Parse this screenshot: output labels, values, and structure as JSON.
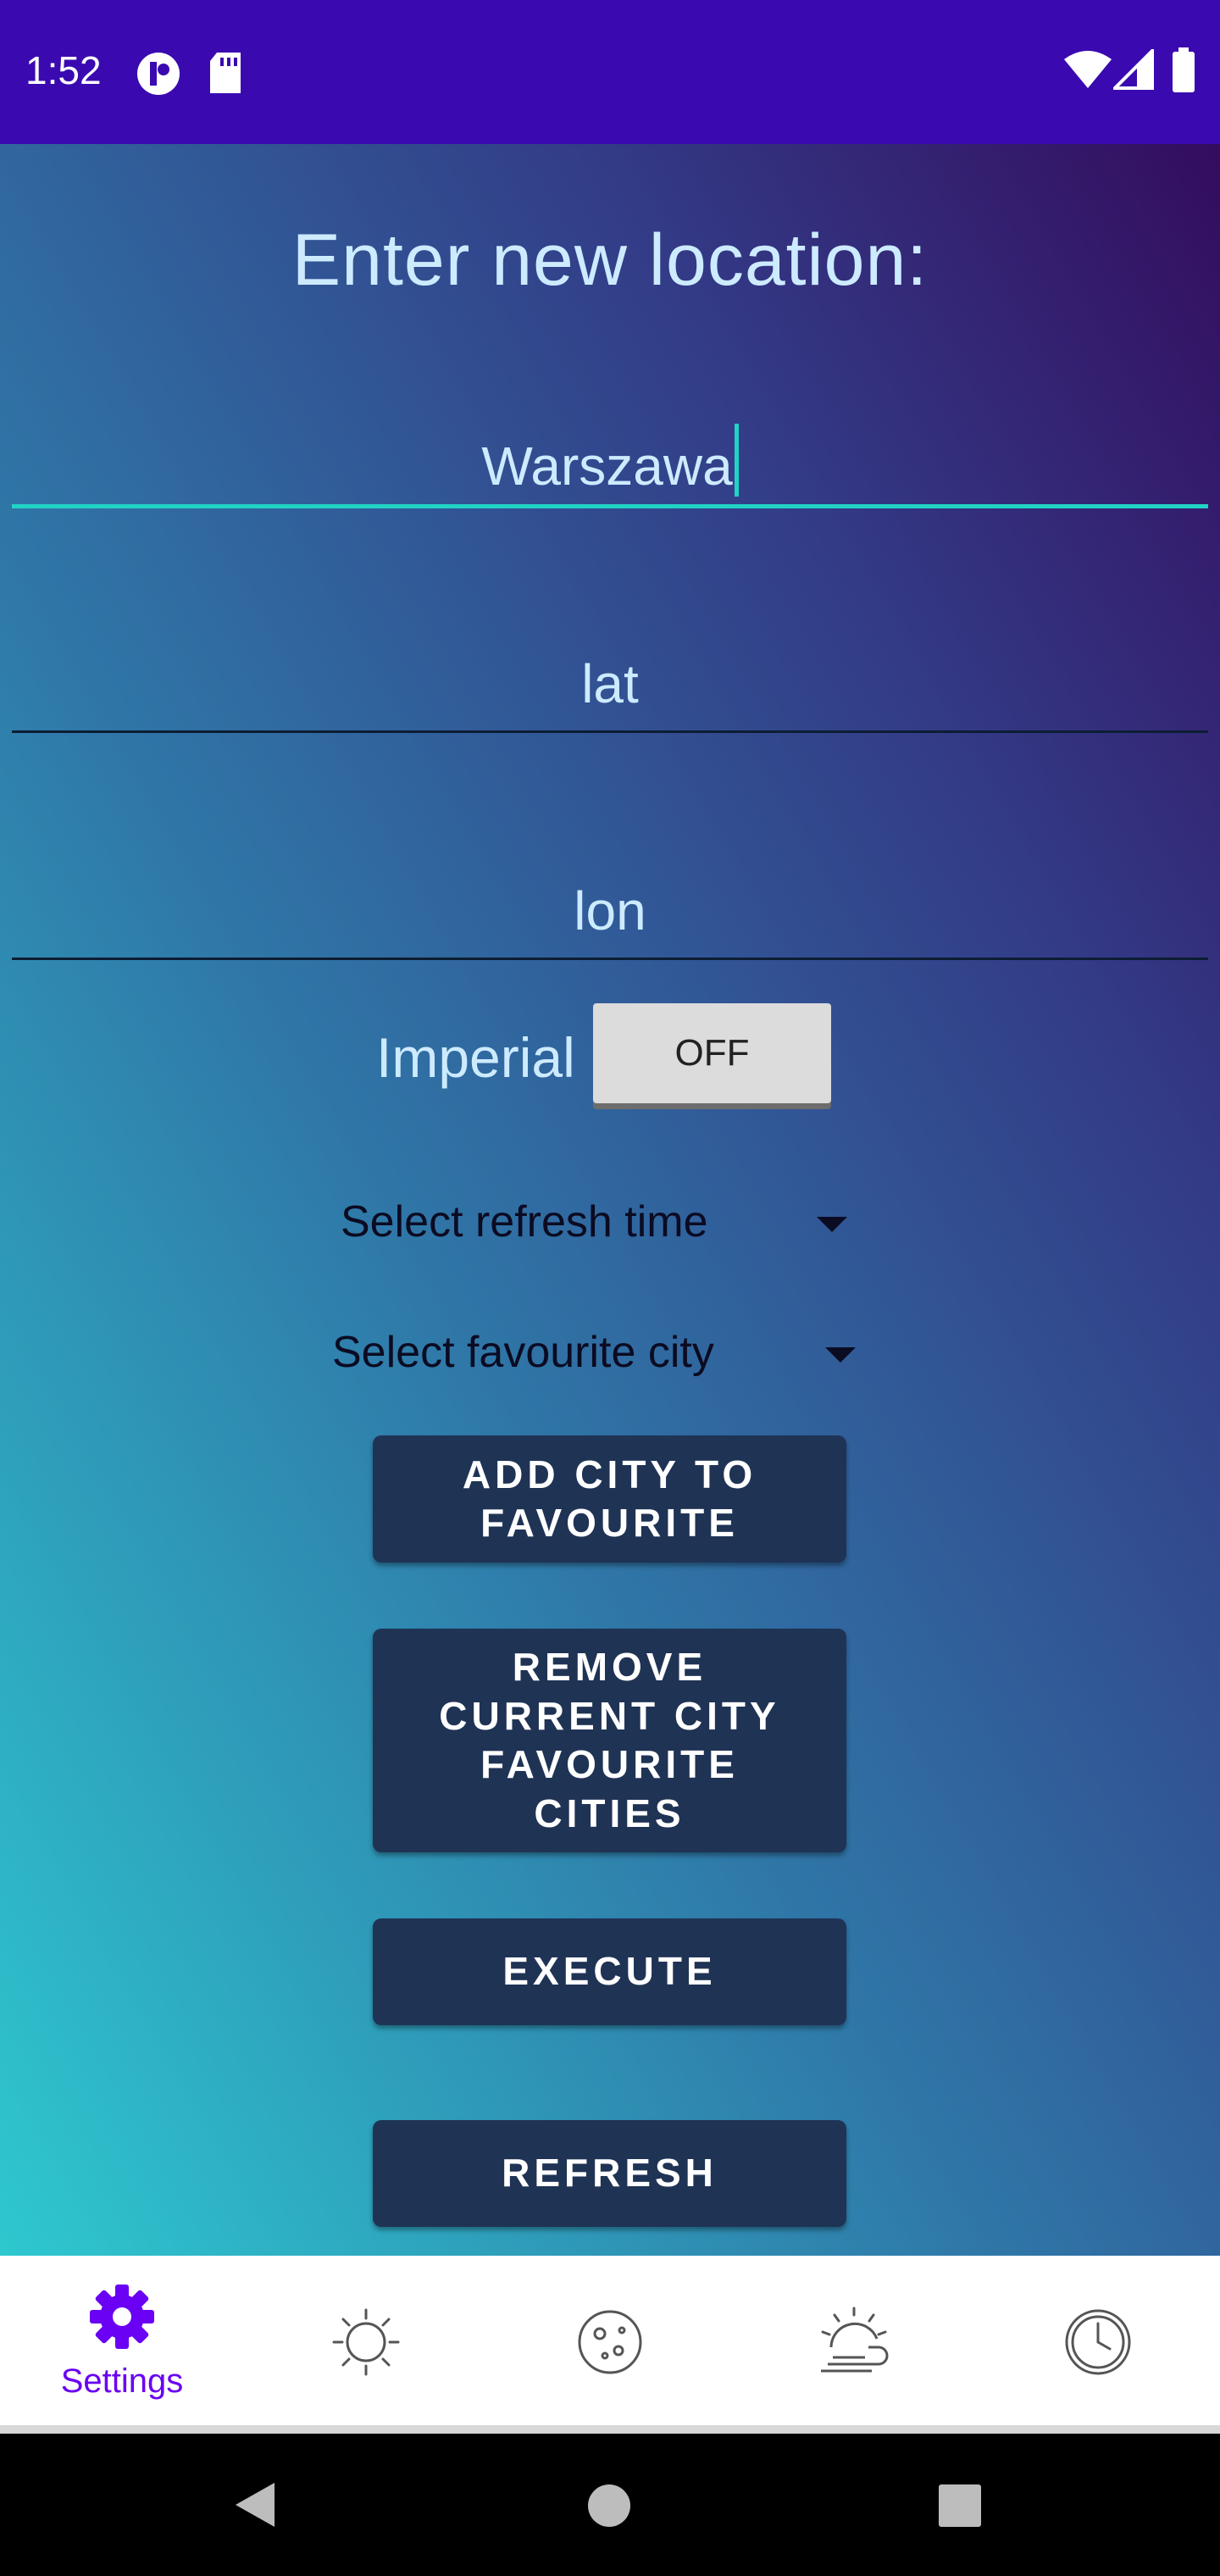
{
  "status_bar": {
    "time": "1:52",
    "icons": [
      "notification-app-icon",
      "sd-card-icon",
      "wifi-icon",
      "signal-icon",
      "battery-icon"
    ]
  },
  "form": {
    "heading": "Enter new location:",
    "city_value": "Warszawa",
    "lat_placeholder": "lat",
    "lon_placeholder": "lon",
    "imperial_label": "Imperial",
    "imperial_toggle": "OFF",
    "refresh_select": "Select refresh time",
    "favourite_select": "Select favourite city"
  },
  "buttons": {
    "add_favourite": "ADD CITY TO\nFAVOURITE",
    "remove_favourite": "REMOVE\nCURRENT CITY\nFAVOURITE\nCITIES",
    "execute": "EXECUTE",
    "refresh": "REFRESH"
  },
  "bottom_nav": {
    "items": [
      {
        "label": "Settings",
        "icon": "gear-icon",
        "active": true
      },
      {
        "label": "",
        "icon": "sun-icon",
        "active": false
      },
      {
        "label": "",
        "icon": "moon-icon",
        "active": false
      },
      {
        "label": "",
        "icon": "weather-icon",
        "active": false
      },
      {
        "label": "",
        "icon": "clock-icon",
        "active": false
      }
    ]
  },
  "colors": {
    "status_bar": "#3a0ab0",
    "accent": "#21d3c4",
    "active_nav": "#6a00f4",
    "button": "#1f3355"
  }
}
